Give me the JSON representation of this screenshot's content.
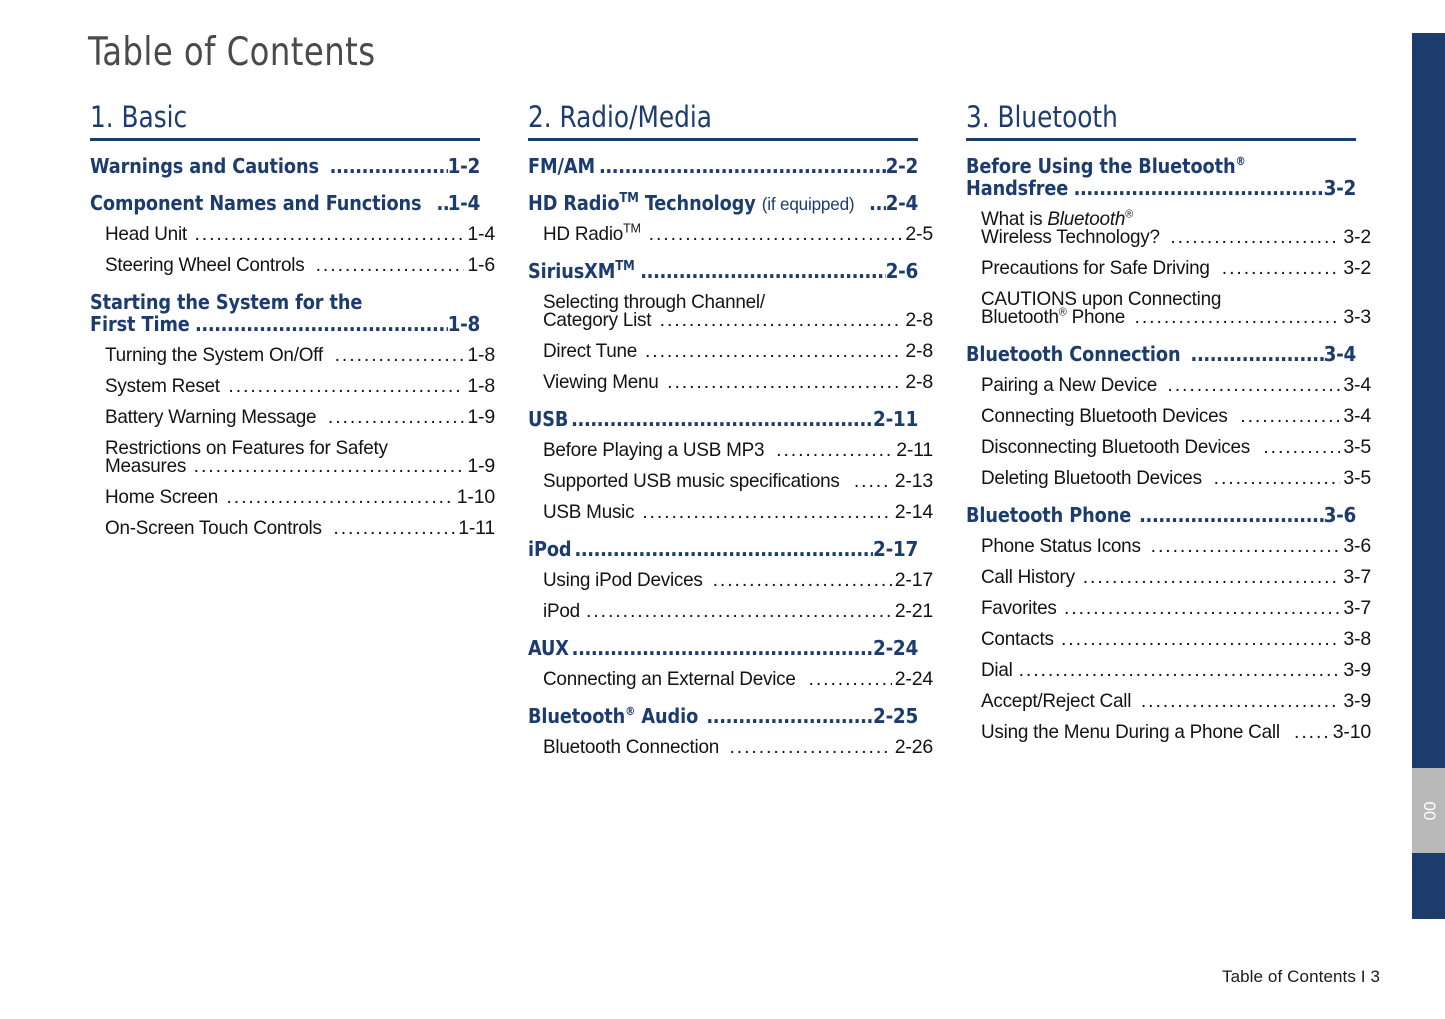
{
  "page": {
    "title": "Table of Contents",
    "footer": "Table of Contents I 3",
    "edge_tab_label": "00",
    "accent_color": "#1d3c6e",
    "title_color": "#4a4a4a",
    "body_color": "#131313",
    "edge_marker_color": "#b9b9b9"
  },
  "columns": [
    {
      "heading": "1. Basic",
      "entries": [
        {
          "level": 1,
          "text": "Warnings and Cautions",
          "page": "1-2"
        },
        {
          "level": 1,
          "text": "Component Names and Functions",
          "page": "1-4"
        },
        {
          "level": 2,
          "text": "Head Unit",
          "page": "1-4"
        },
        {
          "level": 2,
          "text": "Steering Wheel Controls",
          "page": "1-6"
        },
        {
          "level": 1,
          "text": "Starting the System for the",
          "page": "",
          "wrap": "first"
        },
        {
          "level": 1,
          "text": "First Time",
          "page": "1-8",
          "wrap": "second"
        },
        {
          "level": 2,
          "text": "Turning the System On/Off",
          "page": "1-8"
        },
        {
          "level": 2,
          "text": "System Reset",
          "page": "1-8"
        },
        {
          "level": 2,
          "text": "Battery Warning Message",
          "page": "1-9"
        },
        {
          "level": 2,
          "text": "Restrictions on Features for Safety",
          "page": "",
          "wrap": "first"
        },
        {
          "level": 2,
          "text": "Measures",
          "page": "1-9",
          "wrap": "second"
        },
        {
          "level": 2,
          "text": "Home Screen",
          "page": "1-10"
        },
        {
          "level": 2,
          "text": "On-Screen Touch Controls",
          "page": "1-11"
        }
      ]
    },
    {
      "heading": "2. Radio/Media",
      "entries": [
        {
          "level": 1,
          "text": "FM/AM",
          "page": "2-2"
        },
        {
          "level": 1,
          "text": "HD Radio<tm>TM</tm> Technology <light>(if equipped)</light>",
          "page": "2-4",
          "html": true
        },
        {
          "level": 2,
          "text": "HD Radio<tm>TM</tm>",
          "page": "2-5",
          "html": true
        },
        {
          "level": 1,
          "text": "SiriusXM<tm>TM</tm>",
          "page": "2-6",
          "html": true
        },
        {
          "level": 2,
          "text": "Selecting through Channel/",
          "page": "",
          "wrap": "first"
        },
        {
          "level": 2,
          "text": "Category List",
          "page": "2-8",
          "wrap": "second"
        },
        {
          "level": 2,
          "text": "Direct Tune",
          "page": "2-8"
        },
        {
          "level": 2,
          "text": "Viewing Menu",
          "page": "2-8"
        },
        {
          "level": 1,
          "text": "USB",
          "page": "2-11"
        },
        {
          "level": 2,
          "text": "Before Playing a USB MP3",
          "page": "2-11"
        },
        {
          "level": 2,
          "text": "Supported USB music specifications",
          "page": "2-13"
        },
        {
          "level": 2,
          "text": "USB Music",
          "page": "2-14"
        },
        {
          "level": 1,
          "text": "iPod",
          "page": "2-17"
        },
        {
          "level": 2,
          "text": "Using iPod Devices",
          "page": "2-17"
        },
        {
          "level": 2,
          "text": "iPod",
          "page": "2-21"
        },
        {
          "level": 1,
          "text": "AUX",
          "page": "2-24"
        },
        {
          "level": 2,
          "text": "Connecting an External Device",
          "page": "2-24"
        },
        {
          "level": 1,
          "text": "Bluetooth<sup>&reg;</sup> Audio",
          "page": "2-25",
          "html": true
        },
        {
          "level": 2,
          "text": "Bluetooth Connection",
          "page": "2-26"
        }
      ]
    },
    {
      "heading": "3. Bluetooth",
      "entries": [
        {
          "level": 1,
          "text": "Before Using the Bluetooth<sup>&reg;</sup>",
          "page": "",
          "wrap": "first",
          "html": true
        },
        {
          "level": 1,
          "text": "Handsfree",
          "page": "3-2",
          "wrap": "second"
        },
        {
          "level": 2,
          "text": "What is <i>Bluetooth</i><sup>&reg;</sup>",
          "page": "",
          "wrap": "first",
          "html": true
        },
        {
          "level": 2,
          "text": "Wireless Technology?",
          "page": "3-2",
          "wrap": "second"
        },
        {
          "level": 2,
          "text": "Precautions for Safe Driving",
          "page": "3-2"
        },
        {
          "level": 2,
          "text": "CAUTIONS upon Connecting",
          "page": "",
          "wrap": "first"
        },
        {
          "level": 2,
          "text": "Bluetooth<sup>&reg;</sup> Phone",
          "page": "3-3",
          "wrap": "second",
          "html": true
        },
        {
          "level": 1,
          "text": "Bluetooth Connection",
          "page": "3-4"
        },
        {
          "level": 2,
          "text": "Pairing a New Device",
          "page": "3-4"
        },
        {
          "level": 2,
          "text": "Connecting Bluetooth Devices",
          "page": "3-4"
        },
        {
          "level": 2,
          "text": "Disconnecting Bluetooth Devices",
          "page": "3-5"
        },
        {
          "level": 2,
          "text": "Deleting Bluetooth Devices",
          "page": "3-5"
        },
        {
          "level": 1,
          "text": "Bluetooth Phone",
          "page": "3-6"
        },
        {
          "level": 2,
          "text": "Phone Status Icons",
          "page": "3-6"
        },
        {
          "level": 2,
          "text": "Call History",
          "page": "3-7"
        },
        {
          "level": 2,
          "text": "Favorites",
          "page": "3-7"
        },
        {
          "level": 2,
          "text": "Contacts",
          "page": "3-8"
        },
        {
          "level": 2,
          "text": "Dial",
          "page": "3-9"
        },
        {
          "level": 2,
          "text": "Accept/Reject Call",
          "page": "3-9"
        },
        {
          "level": 2,
          "text": "Using the Menu During a Phone Call",
          "page": "3-10"
        }
      ]
    }
  ]
}
